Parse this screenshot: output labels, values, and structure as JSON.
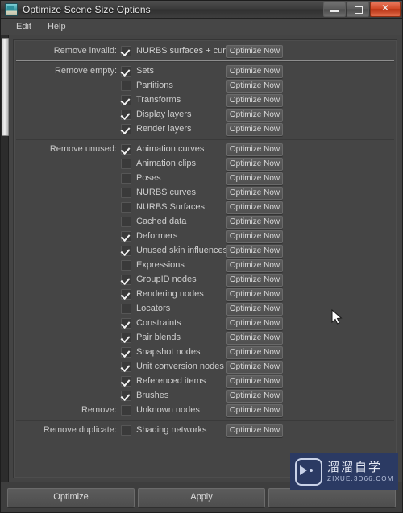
{
  "window": {
    "title": "Optimize Scene Size Options",
    "icon": "maya-app-icon",
    "controls": [
      {
        "name": "minimize-button",
        "label": ""
      },
      {
        "name": "maximize-button",
        "label": ""
      },
      {
        "name": "close-button",
        "label": "✕"
      }
    ]
  },
  "menubar": {
    "items": [
      {
        "label": "Edit"
      },
      {
        "label": "Help"
      }
    ]
  },
  "options": {
    "button_label": "Optimize Now",
    "groups": [
      {
        "rows": [
          {
            "group_label": "Remove invalid:",
            "label": "NURBS surfaces + curves",
            "checked": true
          }
        ]
      },
      {
        "rows": [
          {
            "group_label": "Remove empty:",
            "label": "Sets",
            "checked": true
          },
          {
            "group_label": "",
            "label": "Partitions",
            "checked": false
          },
          {
            "group_label": "",
            "label": "Transforms",
            "checked": true
          },
          {
            "group_label": "",
            "label": "Display layers",
            "checked": true
          },
          {
            "group_label": "",
            "label": "Render layers",
            "checked": true
          }
        ]
      },
      {
        "rows": [
          {
            "group_label": "Remove unused:",
            "label": "Animation curves",
            "checked": true
          },
          {
            "group_label": "",
            "label": "Animation clips",
            "checked": false
          },
          {
            "group_label": "",
            "label": "Poses",
            "checked": false
          },
          {
            "group_label": "",
            "label": "NURBS curves",
            "checked": false
          },
          {
            "group_label": "",
            "label": "NURBS Surfaces",
            "checked": false
          },
          {
            "group_label": "",
            "label": "Cached data",
            "checked": false
          },
          {
            "group_label": "",
            "label": "Deformers",
            "checked": true
          },
          {
            "group_label": "",
            "label": "Unused skin influences",
            "checked": true
          },
          {
            "group_label": "",
            "label": "Expressions",
            "checked": false
          },
          {
            "group_label": "",
            "label": "GroupID nodes",
            "checked": true
          },
          {
            "group_label": "",
            "label": "Rendering nodes",
            "checked": true
          },
          {
            "group_label": "",
            "label": "Locators",
            "checked": false
          },
          {
            "group_label": "",
            "label": "Constraints",
            "checked": true
          },
          {
            "group_label": "",
            "label": "Pair blends",
            "checked": true
          },
          {
            "group_label": "",
            "label": "Snapshot nodes",
            "checked": true
          },
          {
            "group_label": "",
            "label": "Unit conversion nodes",
            "checked": true
          },
          {
            "group_label": "",
            "label": "Referenced items",
            "checked": true
          },
          {
            "group_label": "",
            "label": "Brushes",
            "checked": true
          },
          {
            "group_label": "Remove:",
            "label": "Unknown nodes",
            "checked": false
          }
        ]
      },
      {
        "rows": [
          {
            "group_label": "Remove duplicate:",
            "label": "Shading networks",
            "checked": false
          }
        ]
      }
    ]
  },
  "bottom": {
    "buttons": [
      {
        "name": "optimize-button",
        "label": "Optimize"
      },
      {
        "name": "apply-button",
        "label": "Apply"
      },
      {
        "name": "close-button",
        "label": ""
      }
    ]
  },
  "watermark": {
    "cn": "溜溜自学",
    "en": "ZIXUE.3D66.COM"
  },
  "colors": {
    "background": "#454545",
    "panel": "#454545",
    "titlebar": "#3e3e3e",
    "close_red": "#c0391b",
    "separator": "#8e8e8e",
    "text": "#cdcdcd",
    "watermark_bg": "#2b3a63"
  }
}
